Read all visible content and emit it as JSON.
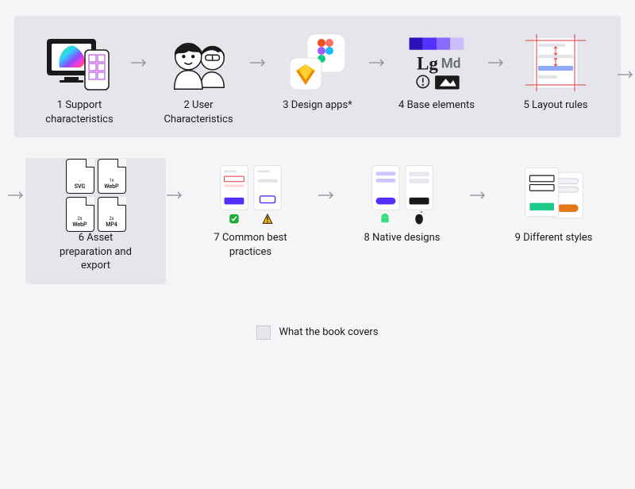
{
  "steps": [
    {
      "n": "1",
      "label": "Support characteristics"
    },
    {
      "n": "2",
      "label": "User Characteristics"
    },
    {
      "n": "3",
      "label": "Design apps*"
    },
    {
      "n": "4",
      "label": "Base elements",
      "lg": "Lg",
      "md": "Md"
    },
    {
      "n": "5",
      "label": "Layout rules"
    },
    {
      "n": "6",
      "label": "Asset preparation and export",
      "files": [
        {
          "pre": "-",
          "ext": "SVG"
        },
        {
          "pre": "1x",
          "ext": "WebP"
        },
        {
          "pre": "2x",
          "ext": "WebP"
        },
        {
          "pre": "2x",
          "ext": "MP4"
        }
      ]
    },
    {
      "n": "7",
      "label": "Common best practices"
    },
    {
      "n": "8",
      "label": "Native designs"
    },
    {
      "n": "9",
      "label": "Different styles"
    }
  ],
  "legend": "What the book covers"
}
